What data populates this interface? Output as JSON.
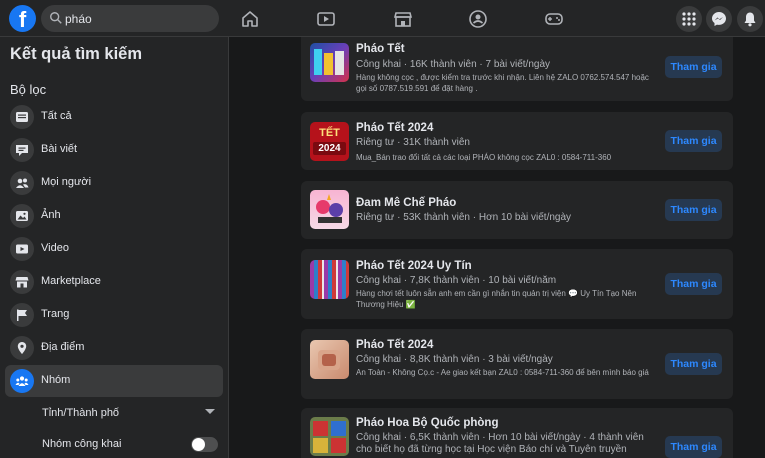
{
  "topbar": {
    "logo_letter": "f",
    "search_value": "pháo",
    "nav_icons": [
      "home-icon",
      "video-icon",
      "marketplace-icon",
      "groups-icon",
      "gaming-icon"
    ],
    "right_icons": [
      "menu-grid-icon",
      "messenger-icon",
      "bell-icon"
    ]
  },
  "sidebar": {
    "title": "Kết quả tìm kiếm",
    "filter_heading": "Bộ lọc",
    "items": [
      {
        "label": "Tất cả",
        "icon": "all-results-icon"
      },
      {
        "label": "Bài viết",
        "icon": "posts-icon"
      },
      {
        "label": "Mọi người",
        "icon": "people-icon"
      },
      {
        "label": "Ảnh",
        "icon": "photos-icon"
      },
      {
        "label": "Video",
        "icon": "video-icon"
      },
      {
        "label": "Marketplace",
        "icon": "marketplace-icon"
      },
      {
        "label": "Trang",
        "icon": "pages-flag-icon"
      },
      {
        "label": "Địa điểm",
        "icon": "location-pin-icon"
      },
      {
        "label": "Nhóm",
        "icon": "groups-icon",
        "active": true
      }
    ],
    "sub_filters": {
      "province": "Tỉnh/Thành phố",
      "public_groups": "Nhóm công khai",
      "public_groups_on": false
    }
  },
  "results": [
    {
      "name": "Pháo Tết",
      "meta": "Công khai · 16K thành viên · 7 bài viết/ngày",
      "desc": "Hàng không cọc , được kiểm tra trước khi nhận. Liên hệ ZALO 0762.574.547 hoặc gọi số 0787.519.591 để đặt hàng .",
      "join": "Tham gia"
    },
    {
      "name": "Pháo Tết 2024",
      "meta": "Riêng tư · 31K thành viên",
      "desc": "Mua_Bán trao đổi tất cả các loại PHÁO không cọc ZAL0 : 0584-711-360",
      "thumb_text": [
        "TẾT",
        "2024"
      ],
      "join": "Tham gia"
    },
    {
      "name": "Đam Mê Chế Pháo",
      "meta": "Riêng tư · 53K thành viên · Hơn 10 bài viết/ngày",
      "desc": "",
      "join": "Tham gia"
    },
    {
      "name": "Pháo Tết 2024 Uy Tín",
      "meta": "Công khai · 7,8K thành viên · 10 bài viết/năm",
      "desc": "Hàng chơi tết luôn sẵn anh em cần gì nhắn tin quản trị viện 💬 Uy Tín Tạo Nên Thương Hiệu ✅",
      "join": "Tham gia"
    },
    {
      "name": "Pháo Tết 2024",
      "meta": "Công khai · 8,8K thành viên · 3 bài viết/ngày",
      "desc": "An Toàn - Không Cọ.c - Ae giao kết bạn ZAL0 : 0584-711-360 để bên mình báo giá",
      "join": "Tham gia"
    },
    {
      "name": "Pháo Hoa Bộ Quốc phòng",
      "meta": "Công khai · 6,5K thành viên · Hơn 10 bài viết/ngày · 4 thành viên cho biết họ đã từng học tại Học viện Báo chí và Tuyên truyền",
      "desc": "",
      "join": "Tham gia"
    }
  ],
  "colors": {
    "accent": "#1877f2",
    "join_text": "#2d88ff",
    "join_bg": "#263951",
    "panel": "#242526",
    "page": "#18191a"
  }
}
